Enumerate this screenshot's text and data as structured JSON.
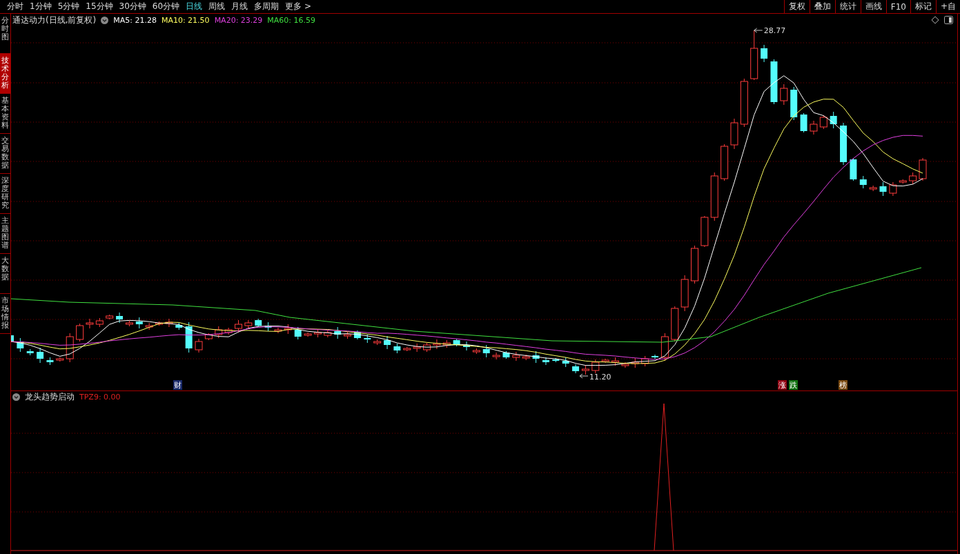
{
  "periods": [
    {
      "label": "分时",
      "selected": false
    },
    {
      "label": "1分钟",
      "selected": false
    },
    {
      "label": "5分钟",
      "selected": false
    },
    {
      "label": "15分钟",
      "selected": false
    },
    {
      "label": "30分钟",
      "selected": false
    },
    {
      "label": "60分钟",
      "selected": false
    },
    {
      "label": "日线",
      "selected": true
    },
    {
      "label": "周线",
      "selected": false
    },
    {
      "label": "月线",
      "selected": false
    },
    {
      "label": "多周期",
      "selected": false
    },
    {
      "label": "更多 >",
      "selected": false
    }
  ],
  "toolbar": [
    "复权",
    "叠加",
    "统计",
    "画线",
    "F10",
    "标记",
    "+自"
  ],
  "sidebar": {
    "tabs": [
      {
        "label": "分时图",
        "selected": false
      },
      {
        "label": "技术分析",
        "selected": true
      },
      {
        "label": "基本资料",
        "selected": false
      },
      {
        "label": "交易数据",
        "selected": false
      },
      {
        "label": "深度研究",
        "selected": false
      },
      {
        "label": "主题图谱",
        "selected": false
      },
      {
        "label": "大数据",
        "selected": false
      },
      {
        "label": "市场情报",
        "selected": false
      }
    ]
  },
  "main_chart": {
    "title": "通达动力(日线,前复权)",
    "indicators": [
      {
        "label": "MA5: 21.28",
        "color": "#ffffff"
      },
      {
        "label": "MA10: 21.50",
        "color": "#ffff60"
      },
      {
        "label": "MA20: 23.29",
        "color": "#e040e0"
      },
      {
        "label": "MA60: 16.59",
        "color": "#40e040"
      }
    ],
    "high_label": "28.77",
    "low_label": "11.20",
    "markers": [
      {
        "label": "财",
        "kind": "finance"
      },
      {
        "label": "涨",
        "kind": "rise"
      },
      {
        "label": "跌",
        "kind": "fall"
      },
      {
        "label": "榜",
        "kind": "rank"
      }
    ]
  },
  "indicator_panel": {
    "title": "龙头趋势启动",
    "reading": "TPZ9: 0.00"
  }
}
